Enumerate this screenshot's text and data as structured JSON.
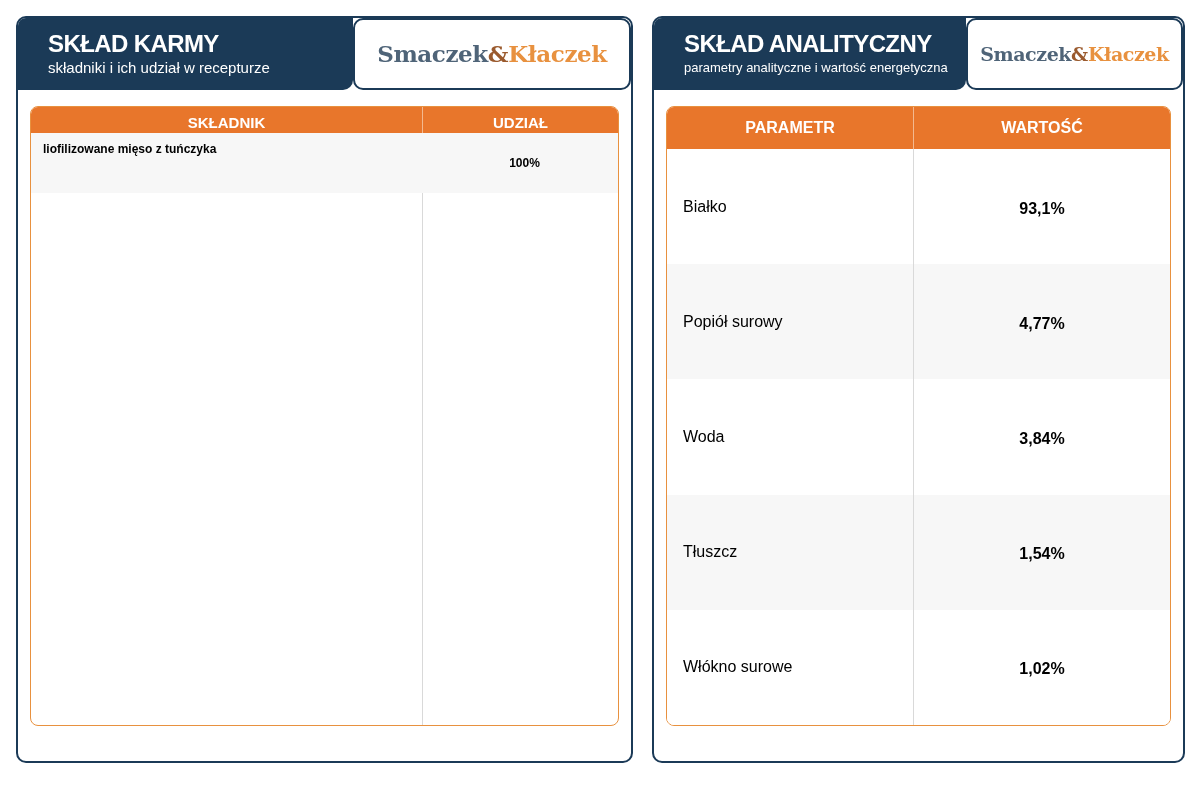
{
  "panels": [
    {
      "title": "SKŁAD KARMY",
      "subtitle": "składniki i ich udział w recepturze",
      "logo": [
        {
          "text": "Smaczek",
          "color": "#4f6478"
        },
        {
          "text": "&",
          "color": "#9a5a2e"
        },
        {
          "text": "Kłaczek",
          "color": "#e8913f"
        }
      ],
      "kind": "composition",
      "table": {
        "columns": [
          "SKŁADNIK",
          "UDZIAŁ"
        ],
        "rows": [
          [
            "liofilizowane mięso z tuńczyka",
            "100%"
          ]
        ]
      }
    },
    {
      "title": "SKŁAD ANALITYCZNY",
      "subtitle": "parametry analityczne i wartość energetyczna",
      "logo": [
        {
          "text": "Smaczek",
          "color": "#4f6478"
        },
        {
          "text": "&",
          "color": "#9a5a2e"
        },
        {
          "text": "Kłaczek",
          "color": "#e8913f"
        }
      ],
      "kind": "analysis",
      "table": {
        "columns": [
          "PARAMETR",
          "WARTOŚĆ"
        ],
        "rows": [
          [
            "Białko",
            "93,1%"
          ],
          [
            "Popiół surowy",
            "4,77%"
          ],
          [
            "Woda",
            "3,84%"
          ],
          [
            "Tłuszcz",
            "1,54%"
          ],
          [
            "Włókno surowe",
            "1,02%"
          ]
        ]
      }
    }
  ]
}
